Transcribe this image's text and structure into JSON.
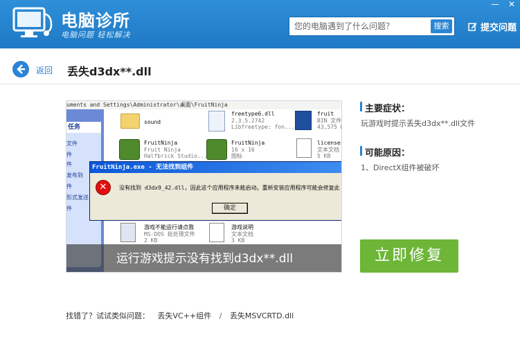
{
  "colors": {
    "brand_blue": "#2b84d4",
    "header_blue": "#2f8fd8",
    "fix_green": "#6db637"
  },
  "window": {
    "minimize": "—",
    "close": "✕"
  },
  "header": {
    "brand_title": "电脑诊所",
    "brand_subtitle": "电脑问题 轻松解决",
    "logo_icon": "monitor-stethoscope-icon",
    "search_placeholder": "您的电脑遇到了什么问题？",
    "search_button": "搜索",
    "ask_label": "提交问题",
    "ask_icon": "edit-icon"
  },
  "titlebar": {
    "back_label": "返回",
    "title": "丢失d3dx**.dll"
  },
  "illustration": {
    "path_text": "uments and Settings\\Administrator\\桌面\\FruitNinja",
    "sidebar_head": "任务",
    "sidebar_items": [
      "文件",
      "件",
      "件",
      "发布到",
      "件",
      "形式发送",
      "件"
    ],
    "files": [
      {
        "name": "sound",
        "sub": ""
      },
      {
        "name": "freetype6.dll",
        "sub": "2.3.5.2742\nLibfreetype: fon..."
      },
      {
        "name": "fruit",
        "sub": "BIN 文件\n43,575 K"
      },
      {
        "name": "FruitNinja",
        "sub": "Fruit Ninja\nHalfbrick Studio..."
      },
      {
        "name": "FruitNinja",
        "sub": "16 x 16\n图标"
      },
      {
        "name": "licenses",
        "sub": "文本文档\n5 KB"
      },
      {
        "name": "游戏不能运行请点我",
        "sub": "MS-DOS 批处理文件\n2 KB"
      },
      {
        "name": "游戏说明",
        "sub": "文本文档\n3 KB"
      }
    ],
    "dialog": {
      "title": "FruitNinja.exe - 无法找到组件",
      "message": "没有找到 d3dx9_42.dll，因此这个应用程序未能启动。重新安装应用程序可能会修复此",
      "ok": "确定"
    },
    "caption": "运行游戏提示没有找到d3dx**.dll"
  },
  "symptoms": {
    "heading": "主要症状：",
    "text": "玩游戏时提示丢失d3dx**.dll文件"
  },
  "causes": {
    "heading": "可能原因：",
    "text": "1、DirectX组件被破坏"
  },
  "fix_button": "立即修复",
  "footer": {
    "prompt": "找错了？试试类似问题：",
    "links": [
      "丢失VC++组件",
      "丢失MSVCRTD.dll"
    ],
    "separator": "/"
  }
}
